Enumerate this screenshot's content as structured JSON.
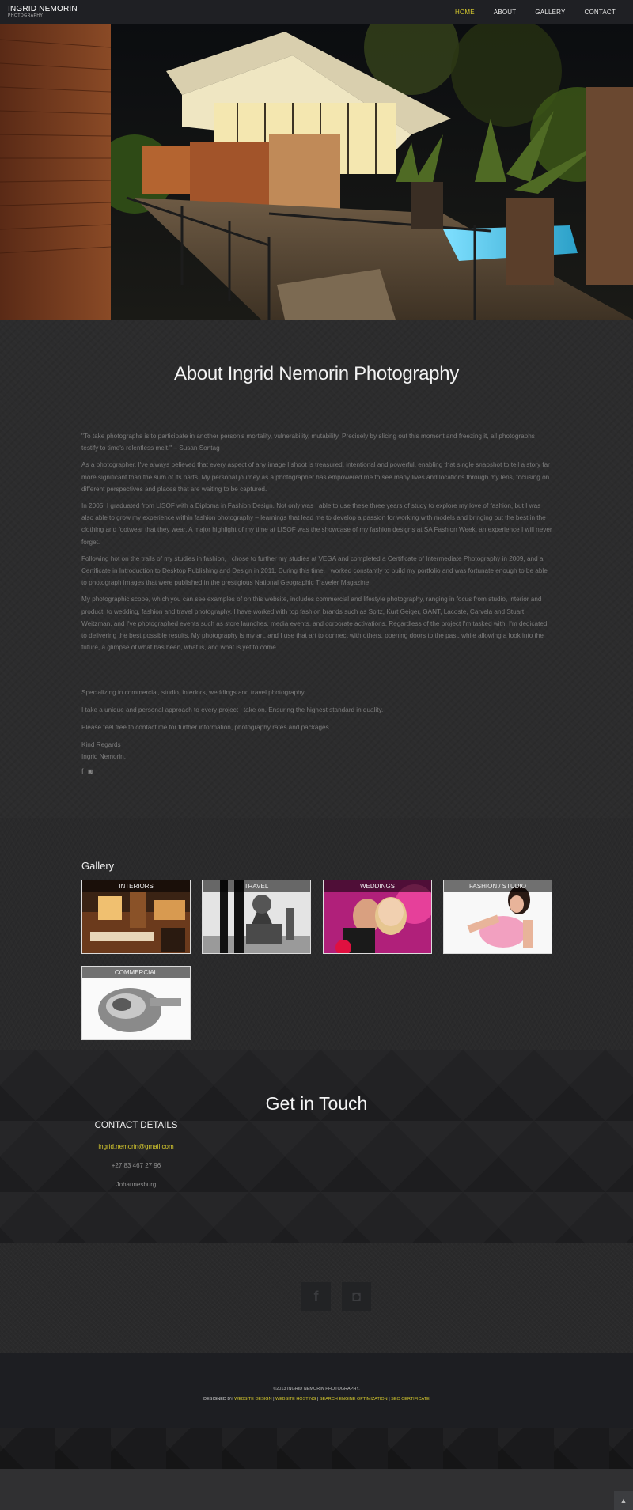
{
  "nav": {
    "brand_name": "INGRID NEMORIN",
    "brand_sub": "PHOTOGRAPHY",
    "items": [
      {
        "label": "HOME"
      },
      {
        "label": "ABOUT"
      },
      {
        "label": "GALLERY"
      },
      {
        "label": "CONTACT"
      }
    ],
    "active": "HOME"
  },
  "about": {
    "title": "About Ingrid Nemorin Photography",
    "paragraphs": [
      "\"To take photographs is to participate in another person's mortality, vulnerability, mutability. Precisely by slicing out this moment and freezing it, all photographs testify to time's relentless melt.\" – Susan Sontag",
      "As a photographer, I've always believed that every aspect of any image I shoot is treasured, intentional and powerful, enabling that single snapshot to tell a story far more significant than the sum of its parts. My personal journey as a photographer has empowered me to see many lives and locations through my lens, focusing on different perspectives and places that are waiting to be captured.",
      "In 2005, I graduated from LISOF with a Diploma in Fashion Design. Not only was I able to use these three years of study to explore my love of fashion, but I was also able to grow my experience within fashion photography – learnings that lead me to develop a passion for working with models and bringing out the best in the clothing and footwear that they wear. A major highlight of my time at LISOF was the showcase of my fashion designs at SA Fashion Week, an experience I will never forget.",
      "Following hot on the trails of my studies in fashion, I chose to further my studies at VEGA and completed a Certificate of Intermediate Photography in 2009, and a Certificate in Introduction to Desktop Publishing and Design in 2011. During this time, I worked constantly to build my portfolio and was fortunate enough to be able to photograph images that were published in the prestigious National Geographic Traveler Magazine.",
      "My photographic scope, which you can see examples of on this website, includes commercial and lifestyle photography, ranging in focus from studio, interior and product, to wedding, fashion and travel photography. I have worked with top fashion brands such as Spitz, Kurt Geiger, GANT, Lacoste, Carvela and Stuart Weitzman, and I've photographed events such as store launches, media events, and corporate activations. Regardless of the project I'm tasked with, I'm dedicated to delivering the best possible results. My photography is my art, and I use that art to connect with others, opening doors to the past, while allowing a look into the future, a glimpse of what has been, what is, and what is yet to come."
    ],
    "extra": [
      "Specializing in commercial, studio, interiors, weddings and travel photography.",
      "I take a unique and personal approach to every project I take on. Ensuring the highest standard in quality.",
      "Please feel free to contact me for further information, photography rates and packages."
    ],
    "sign_1": "Kind Regards",
    "sign_2": "Ingrid Nemorin.",
    "social_icons": [
      "facebook-icon",
      "instagram-icon"
    ]
  },
  "gallery": {
    "title": "Gallery",
    "tiles": [
      {
        "label": "INTERIORS"
      },
      {
        "label": "TRAVEL"
      },
      {
        "label": "WEDDINGS"
      },
      {
        "label": "FASHION / STUDIO"
      },
      {
        "label": "COMMERCIAL"
      }
    ]
  },
  "contact": {
    "title": "Get in Touch",
    "heading": "CONTACT DETAILS",
    "email": "ingrid.nemorin@gmail.com",
    "phone": "+27 83 467 27 96",
    "city": "Johannesburg"
  },
  "social": {
    "facebook_glyph": "f",
    "instagram_glyph": "◘"
  },
  "footer": {
    "copyright": "©2013 INGRID NEMORIN PHOTOGRAPHY.",
    "designed_by": "DESIGNED BY",
    "links": [
      "WEBSITE DESIGN",
      "WEBSITE HOSTING",
      "SEARCH ENGINE OPTIMIZATION",
      "SEO CERTIFICATE"
    ],
    "separator": "|"
  },
  "colors": {
    "accent": "#d8cb2e",
    "nav_bg": "#1f2024",
    "page_bg": "#2b2b2c"
  }
}
